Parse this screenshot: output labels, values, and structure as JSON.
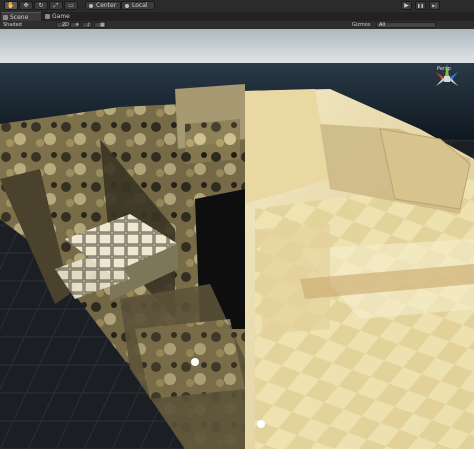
{
  "toolbar": {
    "tools": [
      {
        "icon": "hand-icon",
        "glyph": "✋"
      },
      {
        "icon": "move-icon",
        "glyph": "✥"
      },
      {
        "icon": "rotate-icon",
        "glyph": "↻"
      },
      {
        "icon": "scale-icon",
        "glyph": "⤢"
      },
      {
        "icon": "rect-tool-icon",
        "glyph": "▭"
      }
    ],
    "pivot_label": "Center",
    "space_label": "Local",
    "play_glyph": "▶",
    "pause_glyph": "❚❚",
    "step_glyph": "▶|"
  },
  "tabs": [
    {
      "label": "Scene",
      "icon": "scene-tab-icon"
    },
    {
      "label": "Game",
      "icon": "game-tab-icon"
    }
  ],
  "scene_controls": {
    "shading_mode": "Shaded",
    "mode_2d": "2D",
    "gizmos_label": "Gizmos",
    "search_placeholder": "All"
  },
  "viewport": {
    "projection_label": "Persp",
    "sky_color": "#c9d3d9",
    "sea_color": "#1c2a36",
    "floor_color": "#1b1f24",
    "lit_color": "#e8dba8"
  },
  "gizmo_axes": {
    "x_color": "#d04030",
    "y_color": "#80c040",
    "z_color": "#3c78d8"
  }
}
